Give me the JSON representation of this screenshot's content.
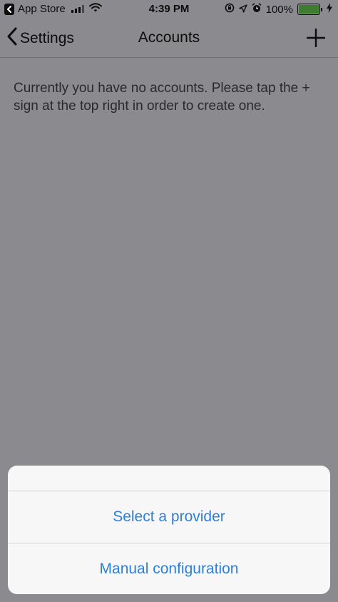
{
  "status_bar": {
    "back_app": "App Store",
    "time": "4:39 PM",
    "battery_percent": "100%",
    "battery_level": 1.0,
    "icons": [
      "back-app-icon",
      "signal-icon",
      "wifi-icon",
      "screen-rotation-lock-icon",
      "location-icon",
      "alarm-icon",
      "battery-icon",
      "charging-icon"
    ]
  },
  "nav": {
    "back_label": "Settings",
    "title": "Accounts",
    "back_icon": "chevron-left-icon",
    "add_icon": "plus-icon"
  },
  "content": {
    "empty_message": "Currently you have no accounts. Please tap the + sign at the top right in order to create one."
  },
  "action_sheet": {
    "options": [
      {
        "label": "Select a provider"
      },
      {
        "label": "Manual configuration"
      }
    ]
  },
  "colors": {
    "accent": "#2d7fdb",
    "dim_background": "#8a8a8f",
    "sheet_background": "#f7f7f7",
    "battery_fill": "#3e7d2f"
  }
}
